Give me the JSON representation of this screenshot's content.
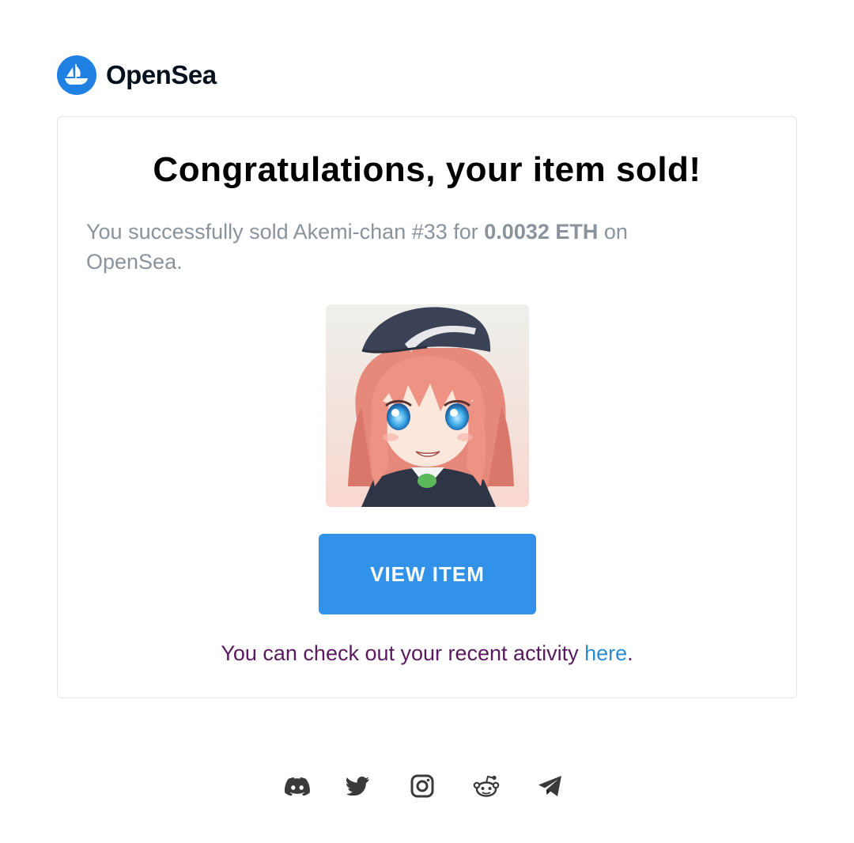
{
  "brand": {
    "name": "OpenSea",
    "logo_icon": "opensea-boat-icon",
    "color": "#2081E2"
  },
  "email": {
    "title": "Congratulations, your item sold!",
    "message": {
      "prefix": "You successfully sold Akemi-chan #33 for ",
      "price": "0.0032 ETH",
      "suffix": " on OpenSea."
    },
    "item_image": "akemi-chan-nft-image",
    "view_button_label": "VIEW ITEM",
    "activity": {
      "prefix": "You can check out your recent activity ",
      "link": "here",
      "suffix": "."
    }
  },
  "footer": {
    "social_icons": [
      "discord-icon",
      "twitter-icon",
      "instagram-icon",
      "reddit-icon",
      "telegram-icon"
    ]
  },
  "colors": {
    "button": "#3291E9",
    "link": "#2E8BD0",
    "muted_text": "#8A939B",
    "activity_text": "#5A1A5F"
  }
}
